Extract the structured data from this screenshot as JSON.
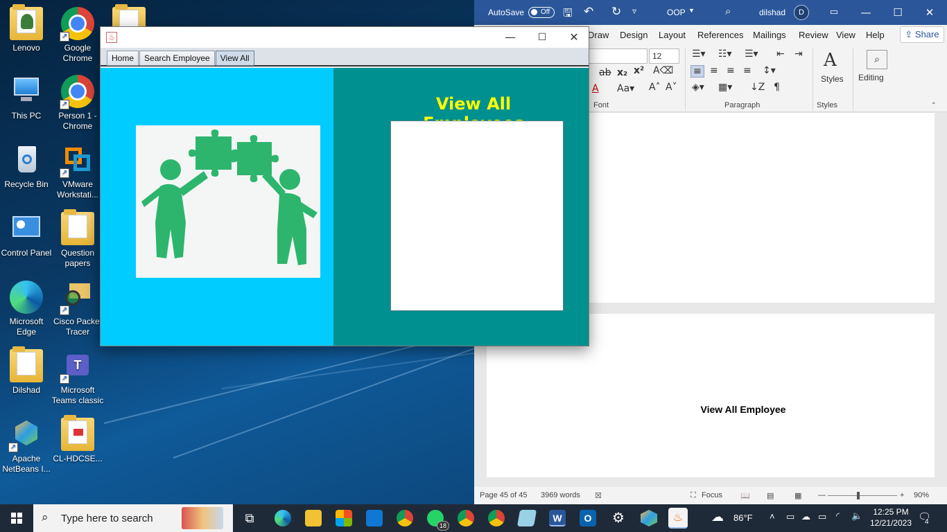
{
  "desktop": {
    "icons": [
      {
        "label": "Lenovo"
      },
      {
        "label": "Google Chrome"
      },
      {
        "label": "This PC"
      },
      {
        "label": "Person 1 - Chrome"
      },
      {
        "label": "Recycle Bin"
      },
      {
        "label": "VMware Workstati..."
      },
      {
        "label": "Control Panel"
      },
      {
        "label": "Question papers"
      },
      {
        "label": "Microsoft Edge"
      },
      {
        "label": "Cisco Packet Tracer"
      },
      {
        "label": "Dilshad"
      },
      {
        "label": "Microsoft Teams classic"
      },
      {
        "label": "Apache NetBeans I..."
      },
      {
        "label": "CL-HDCSE..."
      }
    ]
  },
  "java_app": {
    "tabs": [
      "Home",
      "Search Employee",
      "View All"
    ],
    "active_tab": "View All",
    "heading": "View All Employees",
    "colors": {
      "left_panel": "#00ccff",
      "right_panel": "#009090",
      "heading": "#ffff00",
      "figure": "#2db56d"
    }
  },
  "word": {
    "autosave_label": "AutoSave",
    "autosave_state": "Off",
    "doc_name": "OOP",
    "user": "dilshad",
    "user_initial": "D",
    "menu": [
      "Draw",
      "Design",
      "Layout",
      "References",
      "Mailings",
      "Review",
      "View",
      "Help"
    ],
    "share_label": "Share",
    "font_size": "12",
    "groups": {
      "font": "Font",
      "paragraph": "Paragraph",
      "styles": "Styles"
    },
    "styles_label": "Styles",
    "editing_label": "Editing",
    "page_heading": "View All Employee",
    "status": {
      "page": "Page 45 of 45",
      "words": "3969 words",
      "focus": "Focus",
      "zoom": "90%"
    },
    "accent": "#2b579a"
  },
  "taskbar": {
    "search_placeholder": "Type here to search",
    "whatsapp_badge": "18",
    "weather": "86°F",
    "time": "12:25 PM",
    "date": "12/21/2023",
    "notifications": "4"
  }
}
